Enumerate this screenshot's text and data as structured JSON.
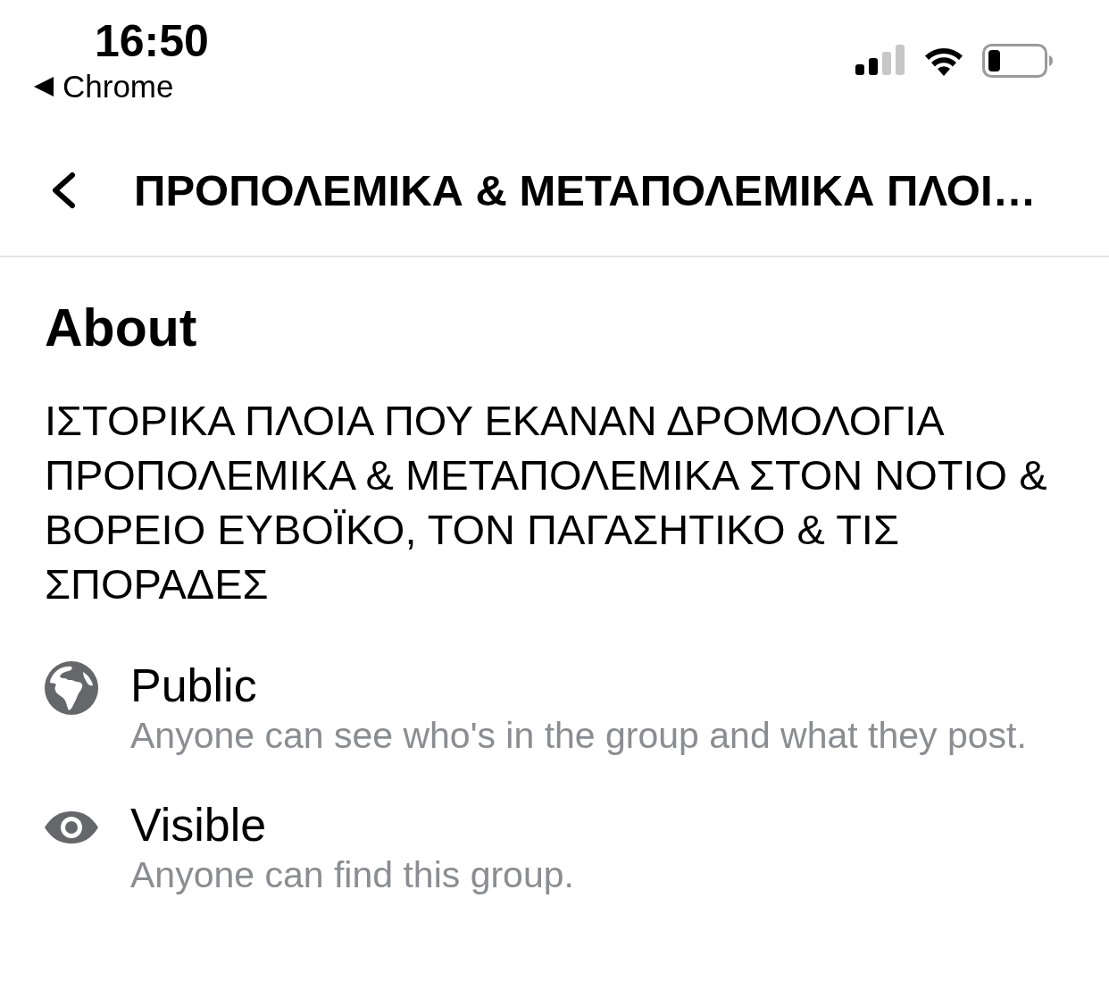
{
  "status_bar": {
    "time": "16:50",
    "back_app": "Chrome"
  },
  "header": {
    "title": "ΠΡΟΠΟΛΕΜΙΚΑ & ΜΕΤΑΠΟΛΕΜΙΚΑ ΠΛΟΙ…"
  },
  "about": {
    "heading": "About",
    "description": "ΙΣΤΟΡΙΚΑ ΠΛΟΙΑ ΠΟΥ ΕΚΑΝΑΝ ΔΡΟΜΟΛΟΓΙΑ ΠΡΟΠΟΛΕΜΙΚΑ & ΜΕΤΑΠΟΛΕΜΙΚΑ ΣΤΟΝ ΝΟΤΙΟ & ΒΟΡΕΙΟ ΕΥΒΟΪΚΟ, ΤΟΝ ΠΑΓΑΣΗΤΙΚΟ & ΤΙΣ ΣΠΟΡΑΔΕΣ",
    "details": [
      {
        "kind": "privacy",
        "title": "Public",
        "subtitle": "Anyone can see who's in the group and what they post."
      },
      {
        "kind": "visibility",
        "title": "Visible",
        "subtitle": "Anyone can find this group."
      }
    ]
  }
}
